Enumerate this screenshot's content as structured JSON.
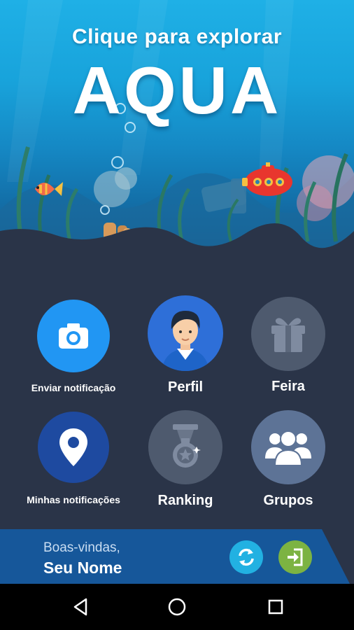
{
  "hero": {
    "subtitle": "Clique para explorar",
    "title": "AQUA"
  },
  "menu": {
    "items": [
      {
        "label": "Enviar notificação",
        "icon": "camera-icon"
      },
      {
        "label": "Perfil",
        "icon": "avatar-icon"
      },
      {
        "label": "Feira",
        "icon": "gift-icon"
      },
      {
        "label": "Minhas notificações",
        "icon": "location-pin-icon"
      },
      {
        "label": "Ranking",
        "icon": "medal-icon"
      },
      {
        "label": "Grupos",
        "icon": "group-icon"
      }
    ]
  },
  "footer": {
    "welcome": "Boas-vindas,",
    "user_name": "Seu Nome",
    "refresh_icon": "refresh-icon",
    "login_icon": "login-icon"
  },
  "navbar": {
    "back_icon": "back-icon",
    "home_icon": "home-icon",
    "recents_icon": "recents-icon"
  },
  "colors": {
    "background": "#2a3448",
    "camera": "#2196f3",
    "profile": "#2e6fd8",
    "disabled": "#4e5a6e",
    "pin": "#1e4aa0",
    "groups": "#5d7396",
    "footer": "#16579a",
    "refresh": "#22b1e2",
    "login": "#7cb342"
  }
}
